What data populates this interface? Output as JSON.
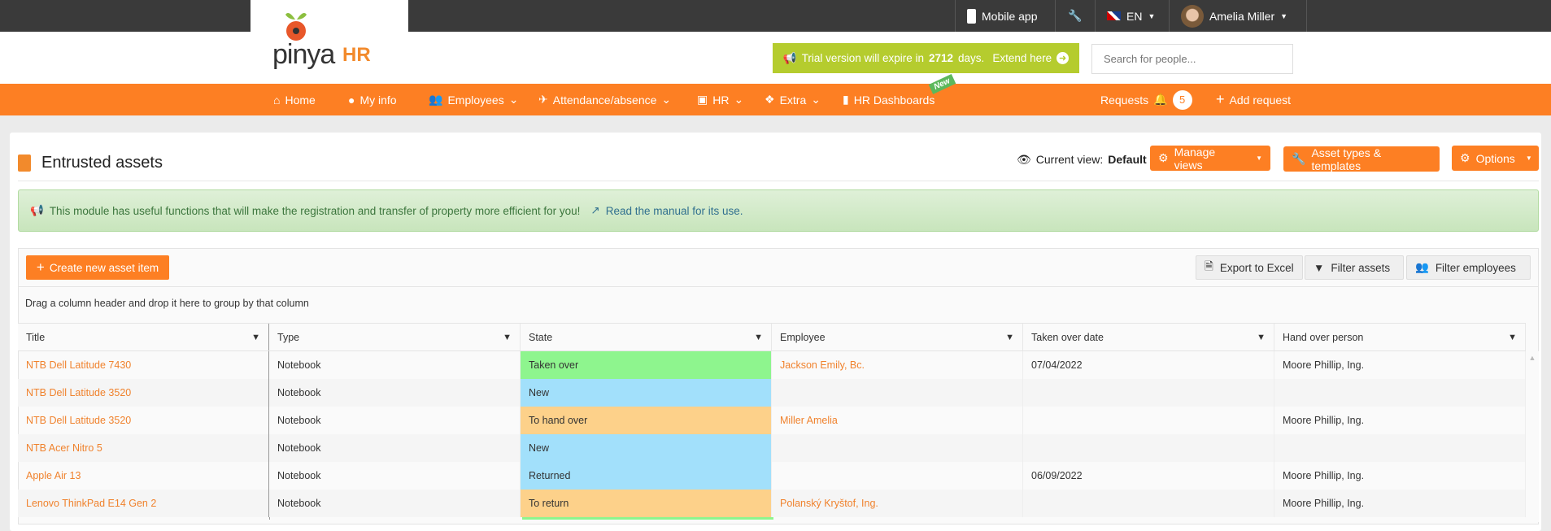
{
  "topbar": {
    "mobile_app": "Mobile app",
    "language": "EN",
    "user_name": "Amelia Miller"
  },
  "logo": {
    "brand": "pinya",
    "suffix": "HR"
  },
  "trial": {
    "prefix": "Trial version will expire in",
    "days": "2712",
    "suffix": "days.",
    "extend": "Extend here"
  },
  "search": {
    "placeholder": "Search for people..."
  },
  "nav": {
    "items": [
      {
        "label": "Home",
        "icon": "home-icon"
      },
      {
        "label": "My info",
        "icon": "user-circle-icon"
      },
      {
        "label": "Employees",
        "icon": "users-icon"
      },
      {
        "label": "Attendance/absence",
        "icon": "plane-icon"
      },
      {
        "label": "HR",
        "icon": "id-card-icon"
      },
      {
        "label": "Extra",
        "icon": "cubes-icon"
      },
      {
        "label": "HR Dashboards",
        "icon": "bar-chart-icon"
      }
    ],
    "new_badge": "New",
    "requests": "Requests",
    "requests_count": "5",
    "add_request": "Add request"
  },
  "page": {
    "title": "Entrusted assets",
    "current_view_label": "Current view:",
    "current_view": "Default",
    "manage_views": "Manage views",
    "asset_types": "Asset types & templates",
    "options": "Options"
  },
  "alert": {
    "text": "This module has useful functions that will make the registration and transfer of property more efficient for you!",
    "link": "Read the manual for its use."
  },
  "grid": {
    "create": "Create new asset item",
    "export": "Export to Excel",
    "filter_assets": "Filter assets",
    "filter_employees": "Filter employees",
    "group_hint": "Drag a column header and drop it here to group by that column",
    "columns": [
      "Title",
      "Type",
      "State",
      "Employee",
      "Taken over date",
      "Hand over person"
    ],
    "rows": [
      {
        "title": "NTB Dell Latitude 7430",
        "type": "Notebook",
        "state": "Taken over",
        "employee": "Jackson Emily, Bc.",
        "date": "07/04/2022",
        "handover": "Moore Phillip, Ing."
      },
      {
        "title": "NTB Dell Latitude 3520",
        "type": "Notebook",
        "state": "New",
        "employee": "",
        "date": "",
        "handover": ""
      },
      {
        "title": "NTB Dell Latitude 3520",
        "type": "Notebook",
        "state": "To hand over",
        "employee": "Miller Amelia",
        "date": "",
        "handover": "Moore Phillip, Ing."
      },
      {
        "title": "NTB Acer Nitro 5",
        "type": "Notebook",
        "state": "New",
        "employee": "",
        "date": "",
        "handover": ""
      },
      {
        "title": "Apple Air 13",
        "type": "Notebook",
        "state": "Returned",
        "employee": "",
        "date": "06/09/2022",
        "handover": "Moore Phillip, Ing."
      },
      {
        "title": "Lenovo ThinkPad E14 Gen 2",
        "type": "Notebook",
        "state": "To return",
        "employee": "Polanský Kryštof, Ing.",
        "date": "",
        "handover": "Moore Phillip, Ing."
      }
    ]
  },
  "state_colors": {
    "Taken over": "#8ef58e",
    "New": "#a2e0fb",
    "Returned": "#a2e0fb",
    "To hand over": "#fdd18a",
    "To return": "#fdd18a"
  },
  "colors": {
    "brand_orange": "#fd7f23",
    "trial_green": "#b5cc2e",
    "topbar": "#3a3a3a"
  }
}
